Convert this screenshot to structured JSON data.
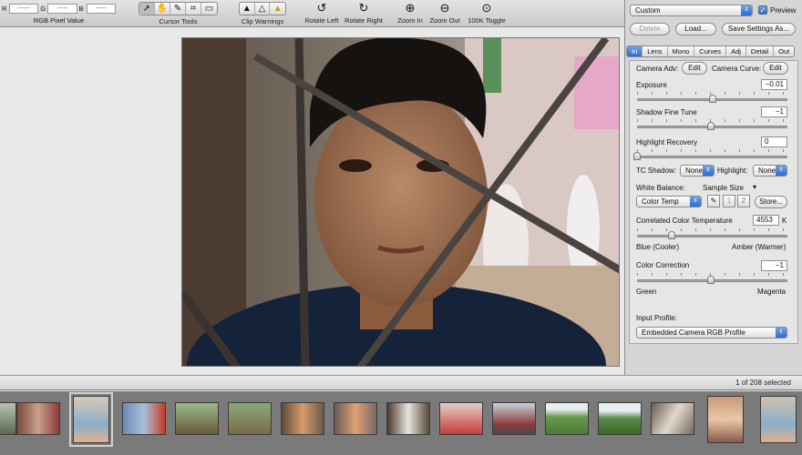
{
  "toolbar": {
    "rgb": {
      "r_label": "R",
      "g_label": "G",
      "b_label": "B",
      "r_value": "------",
      "g_value": "-----",
      "b_value": "-----",
      "caption": "RGB Pixel Value"
    },
    "cursor_tools_label": "Cursor Tools",
    "clip_warnings_label": "Clip Warnings",
    "rotate_left_label": "Rotate Left",
    "rotate_right_label": "Rotate Right",
    "zoom_in_label": "Zoom In",
    "zoom_out_label": "Zoom Out",
    "toggle_100k_label": "100K Toggle",
    "icons": {
      "cursor_tools": [
        "arrow-cursor-icon",
        "hand-icon",
        "eyedropper-icon",
        "crop-icon",
        "white-balance-icon"
      ],
      "clip_warnings": [
        "shadow-clip-warning-icon",
        "midtone-warning-icon",
        "highlight-clip-warning-icon"
      ]
    }
  },
  "panel": {
    "preset_value": "Custom",
    "preview_label": "Preview",
    "preview_checked": true,
    "delete_label": "Delete",
    "load_label": "Load...",
    "save_settings_label": "Save Settings As...",
    "tabs": [
      "In",
      "Lens",
      "Mono",
      "Curves",
      "Adj",
      "Detail",
      "Out"
    ],
    "active_tab": "In",
    "camera_adv_label": "Camera Adv:",
    "camera_adv_edit": "Edit",
    "camera_curve_label": "Camera Curve:",
    "camera_curve_edit": "Edit",
    "exposure_label": "Exposure",
    "exposure_value": "−0.01",
    "exposure_level": 0.5,
    "shadow_fine_tune_label": "Shadow Fine Tune",
    "shadow_fine_tune_value": "−1",
    "shadow_fine_tune_level": 0.49,
    "highlight_recovery_label": "Highlight Recovery",
    "highlight_recovery_value": "0",
    "highlight_recovery_level": 0.0,
    "tc_shadow_label": "TC Shadow:",
    "tc_shadow_value": "None",
    "highlight_label": "Highlight:",
    "highlight_value": "None",
    "white_balance_label": "White Balance:",
    "sample_size_label": "Sample Size",
    "wb_mode_value": "Color Temp",
    "wb_btn1": "1",
    "wb_btn2": "2",
    "store_label": "Store...",
    "cct_label": "Correlated Color Temperature",
    "cct_value": "4553",
    "cct_unit": "K",
    "cct_level": 0.23,
    "blue_label": "Blue (Cooler)",
    "amber_label": "Amber (Warmer)",
    "color_correction_label": "Color Correction",
    "color_correction_value": "−1",
    "color_correction_level": 0.49,
    "green_label": "Green",
    "magenta_label": "Magenta",
    "input_profile_label": "Input Profile:",
    "input_profile_value": "Embedded Camera RGB Profile"
  },
  "status": {
    "selection_text": "1 of 208 selected"
  },
  "colors": {
    "accent": "#2d6cd0",
    "panel_bg": "#d6d6d6",
    "filmstrip_bg": "#7a7a7a"
  }
}
